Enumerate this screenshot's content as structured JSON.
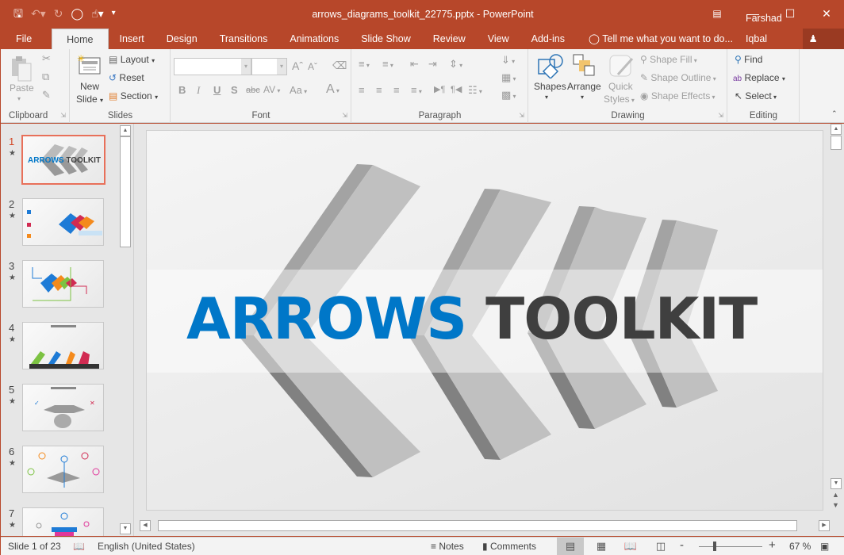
{
  "app": {
    "window_title": "arrows_diagrams_toolkit_22775.pptx - PowerPoint",
    "accent_color": "#b7472a"
  },
  "quick_access": {
    "icons": [
      "save-icon",
      "undo-icon",
      "redo-icon",
      "start-from-beginning-icon",
      "touch-mode-icon",
      "customize-qat-icon"
    ]
  },
  "window_controls": [
    "ribbon-display-options",
    "minimize",
    "maximize",
    "close"
  ],
  "tabs": [
    {
      "label": "File"
    },
    {
      "label": "Home",
      "active": true
    },
    {
      "label": "Insert"
    },
    {
      "label": "Design"
    },
    {
      "label": "Transitions"
    },
    {
      "label": "Animations"
    },
    {
      "label": "Slide Show"
    },
    {
      "label": "Review"
    },
    {
      "label": "View"
    },
    {
      "label": "Add-ins"
    }
  ],
  "tell_me": "Tell me what you want to do...",
  "user_name": "Farshad Iqbal",
  "share_label": "Share",
  "ribbon": {
    "clipboard": {
      "label": "Clipboard",
      "paste": "Paste"
    },
    "slides": {
      "label": "Slides",
      "new_slide_1": "New",
      "new_slide_2": "Slide",
      "layout": "Layout",
      "reset": "Reset",
      "section": "Section"
    },
    "font": {
      "label": "Font",
      "font_name": "",
      "font_size": "",
      "bold": "B",
      "italic": "I",
      "underline": "U",
      "shadow": "S",
      "strike": "abc",
      "spacing": "AV",
      "case": "Aa",
      "color": "A"
    },
    "paragraph": {
      "label": "Paragraph"
    },
    "drawing": {
      "label": "Drawing",
      "shapes": "Shapes",
      "arrange": "Arrange",
      "quick_styles_1": "Quick",
      "quick_styles_2": "Styles",
      "shape_fill": "Shape Fill",
      "shape_outline": "Shape Outline",
      "shape_effects": "Shape Effects"
    },
    "editing": {
      "label": "Editing",
      "find": "Find",
      "replace": "Replace",
      "select": "Select"
    }
  },
  "thumbnails": [
    {
      "number": "1",
      "selected": true,
      "caption": "ARROWS TOOLKIT"
    },
    {
      "number": "2",
      "selected": false
    },
    {
      "number": "3",
      "selected": false
    },
    {
      "number": "4",
      "selected": false
    },
    {
      "number": "5",
      "selected": false
    },
    {
      "number": "6",
      "selected": false
    },
    {
      "number": "7",
      "selected": false
    }
  ],
  "slide": {
    "title_word1": "ARROWS",
    "title_word2": "TOOLKIT",
    "title_color1": "#0077c8",
    "title_color2": "#3f3f3f"
  },
  "status_bar": {
    "slide_counter": "Slide 1 of 23",
    "language": "English (United States)",
    "notes": "Notes",
    "comments": "Comments",
    "zoom": "67 %",
    "zoom_minus": "-",
    "zoom_plus": "+"
  }
}
